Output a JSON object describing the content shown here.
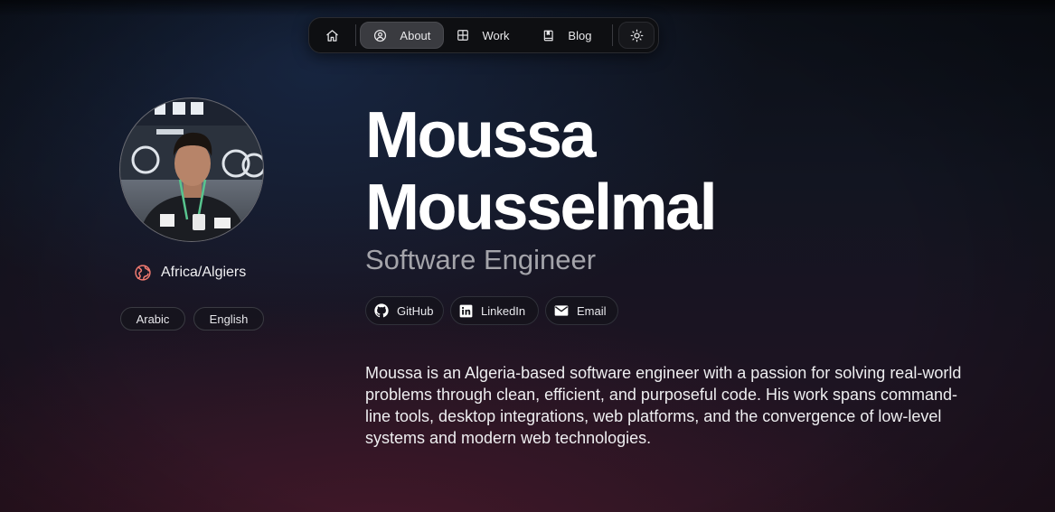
{
  "nav": {
    "items": [
      {
        "id": "home",
        "label": "",
        "icon": "home-icon"
      },
      {
        "id": "about",
        "label": "About",
        "icon": "user-circle-icon",
        "active": true
      },
      {
        "id": "work",
        "label": "Work",
        "icon": "grid-icon"
      },
      {
        "id": "blog",
        "label": "Blog",
        "icon": "book-icon"
      }
    ],
    "theme_toggle_icon": "sun-icon"
  },
  "profile": {
    "avatar_icon": "avatar-photo",
    "location": "Africa/Algiers",
    "location_icon": "globe-icon",
    "languages": [
      "Arabic",
      "English"
    ]
  },
  "hero": {
    "first_name": "Moussa",
    "last_name": "Mousselmal",
    "role": "Software Engineer"
  },
  "socials": [
    {
      "label": "GitHub",
      "icon": "github-icon"
    },
    {
      "label": "LinkedIn",
      "icon": "linkedin-icon"
    },
    {
      "label": "Email",
      "icon": "mail-icon"
    }
  ],
  "bio": "Moussa is an Algeria-based software engineer with a passion for solving real-world problems through clean, efficient, and purposeful code. His work spans command-line tools, desktop integrations, web platforms, and the convergence of low-level systems and modern web technologies.",
  "colors": {
    "background_top": "#0b0f17",
    "background_bottom": "#231320",
    "nav_bg": "#0e0f12",
    "nav_active_bg": "#3a3b40",
    "location_icon": "#f07a70",
    "role_text": "#a4a4aa"
  }
}
